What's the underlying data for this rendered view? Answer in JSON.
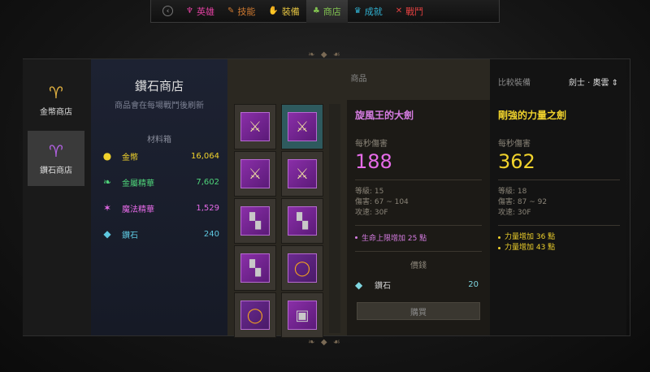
{
  "topnav": {
    "tabs": [
      {
        "label": "英雄",
        "icon": "hero-icon",
        "color": "#e040a0",
        "glyph": "♆"
      },
      {
        "label": "技能",
        "icon": "skill-book-icon",
        "color": "#d07a30",
        "glyph": "✎"
      },
      {
        "label": "裝備",
        "icon": "equipment-icon",
        "color": "#e0c040",
        "glyph": "✋"
      },
      {
        "label": "商店",
        "icon": "shop-bag-icon",
        "color": "#80c050",
        "glyph": "♣",
        "active": true
      },
      {
        "label": "成就",
        "icon": "trophy-icon",
        "color": "#30b0d0",
        "glyph": "♛"
      },
      {
        "label": "戰鬥",
        "icon": "crossed-swords-icon",
        "color": "#e04040",
        "glyph": "✕"
      }
    ]
  },
  "sidebar": {
    "items": [
      {
        "label": "金幣商店",
        "icon": "gold-bag-icon"
      },
      {
        "label": "鑽石商店",
        "icon": "diamond-bag-icon",
        "active": true
      }
    ]
  },
  "shop": {
    "title": "鑽石商店",
    "subtitle": "商品會在每場戰鬥後刷新",
    "materials_header": "材料箱",
    "materials": [
      {
        "name": "金幣",
        "value": "16,064",
        "icon": "gold-coin-icon",
        "color": "#f0d22c"
      },
      {
        "name": "金屬精華",
        "value": "7,602",
        "icon": "metal-essence-icon",
        "color": "#4fd47a"
      },
      {
        "name": "魔法精華",
        "value": "1,529",
        "icon": "magic-essence-icon",
        "color": "#e66be8"
      },
      {
        "name": "鑽石",
        "value": "240",
        "icon": "diamond-icon",
        "color": "#5ec8e0"
      }
    ]
  },
  "goods": {
    "header": "商品",
    "items": [
      {
        "name": "sword-item",
        "icon": "sword-icon",
        "glyph": "⚔"
      },
      {
        "name": "sword-item",
        "icon": "sword-icon",
        "glyph": "⚔",
        "selected": true
      },
      {
        "name": "sword-item",
        "icon": "sword-icon",
        "glyph": "⚔"
      },
      {
        "name": "sword-item",
        "icon": "sword-icon",
        "glyph": "⚔"
      },
      {
        "name": "boots-item",
        "icon": "boots-icon",
        "glyph": "▚"
      },
      {
        "name": "boots-item",
        "icon": "boots-icon",
        "glyph": "▚"
      },
      {
        "name": "boots-item",
        "icon": "boots-icon",
        "glyph": "▚"
      },
      {
        "name": "ring-item",
        "icon": "ring-icon",
        "glyph": "◯"
      },
      {
        "name": "ring-item",
        "icon": "ring-icon",
        "glyph": "◯"
      },
      {
        "name": "armor-item",
        "icon": "armor-icon",
        "glyph": "▣"
      }
    ]
  },
  "detail": {
    "name": "旋風王的大劍",
    "dps_label": "每秒傷害",
    "dps": "188",
    "stats": [
      "等級: 15",
      "傷害: 67 ~ 104",
      "攻速: 30F"
    ],
    "bonuses": [
      "生命上限增加 25 點"
    ],
    "price_header": "價錢",
    "price_currency": "鑽石",
    "price_value": "20",
    "buy_label": "購買"
  },
  "compare": {
    "header": "比較裝備",
    "selector": "劍士 · 奧雲 ⇕",
    "name": "剛強的力量之劍",
    "dps_label": "每秒傷害",
    "dps": "362",
    "stats": [
      "等級: 18",
      "傷害: 87 ~ 92",
      "攻速: 30F"
    ],
    "bonuses": [
      "力量增加 36 點",
      "力量增加 43 點"
    ]
  }
}
